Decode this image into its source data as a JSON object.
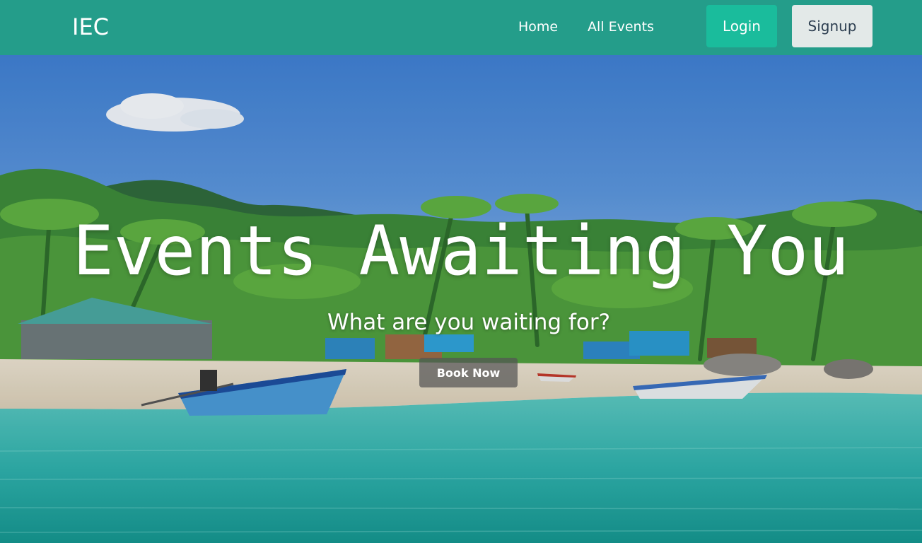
{
  "navbar": {
    "brand": "IEC",
    "links": [
      "Home",
      "All Events"
    ],
    "login_label": "Login",
    "signup_label": "Signup"
  },
  "hero": {
    "title": "Events Awaiting You",
    "subtitle": "What are you waiting for?",
    "cta_label": "Book Now",
    "background": "tropical-beach-photo"
  },
  "colors": {
    "navbar": "#249d8a",
    "login": "#1abc9c",
    "signup": "#e3e9e8"
  }
}
